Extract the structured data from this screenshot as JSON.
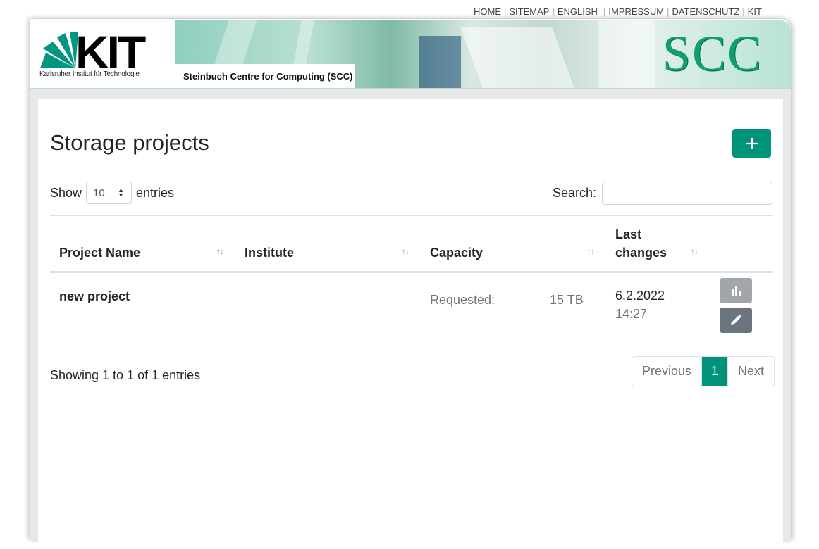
{
  "topnav": {
    "items": [
      "HOME",
      "SITEMAP",
      "ENGLISH",
      "IMPRESSUM",
      "DATENSCHUTZ",
      "KIT"
    ]
  },
  "header": {
    "logo_text": "KIT",
    "logo_subtitle": "Karlsruher Institut für Technologie",
    "banner_label": "Steinbuch Centre for Computing (SCC)",
    "banner_title": "SCC",
    "accent_color": "#00937a"
  },
  "page": {
    "title": "Storage projects",
    "add_icon": "plus-icon"
  },
  "table_controls": {
    "show_label": "Show",
    "entries_value": "10",
    "entries_label": "entries",
    "search_label": "Search:",
    "search_value": ""
  },
  "table": {
    "columns": [
      "Project Name",
      "Institute",
      "Capacity",
      "Last",
      "changes"
    ],
    "rows": [
      {
        "project_name": "new project",
        "institute": "",
        "capacity_label": "Requested:",
        "capacity_value": "15 TB",
        "last_changed_date": "6.2.2022",
        "last_changed_time": "14:27",
        "actions": [
          "bar-chart-icon",
          "pencil-icon"
        ]
      }
    ]
  },
  "footer": {
    "info": "Showing 1 to 1 of 1 entries",
    "pagination": {
      "previous": "Previous",
      "current": "1",
      "next": "Next"
    }
  }
}
